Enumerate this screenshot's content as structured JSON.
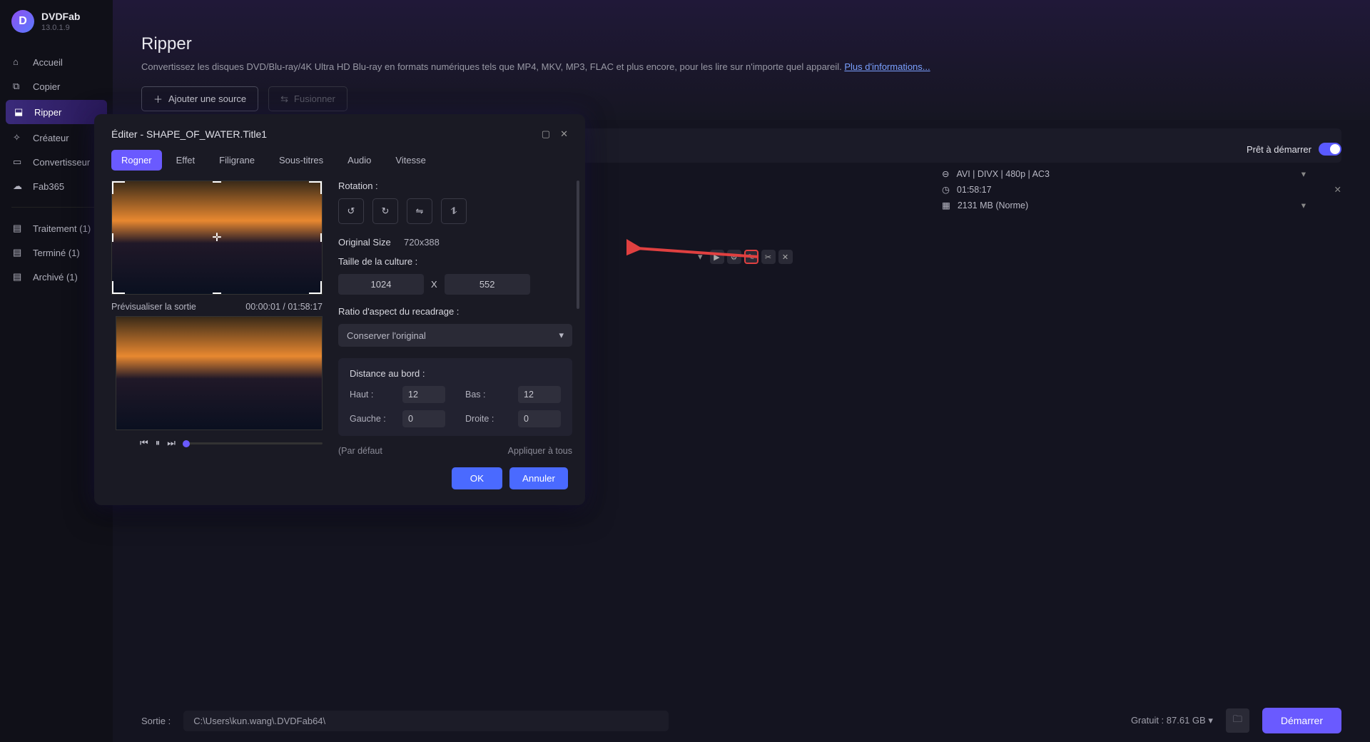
{
  "app": {
    "name": "DVDFab",
    "version": "13.0.1.9"
  },
  "sidebar": {
    "items": [
      {
        "label": "Accueil"
      },
      {
        "label": "Copier"
      },
      {
        "label": "Ripper"
      },
      {
        "label": "Créateur"
      },
      {
        "label": "Convertisseur"
      },
      {
        "label": "Fab365"
      }
    ],
    "status": [
      {
        "label": "Traitement (1)"
      },
      {
        "label": "Terminé (1)"
      },
      {
        "label": "Archivé (1)"
      }
    ]
  },
  "page": {
    "title": "Ripper",
    "desc": "Convertissez les disques DVD/Blu-ray/4K Ultra HD Blu-ray en formats numériques tels que MP4, MKV, MP3, FLAC et plus encore, pour les lire sur n'importe quel appareil. ",
    "more": "Plus d'informations...",
    "add_source": "Ajouter une source",
    "merge": "Fusionner"
  },
  "item": {
    "ready": "Prêt à démarrer",
    "format": "AVI | DIVX | 480p | AC3",
    "duration": "01:58:17",
    "size": "2131 MB (Norme)"
  },
  "footer": {
    "label": "Sortie :",
    "path": "C:\\Users\\kun.wang\\.DVDFab64\\",
    "free": "Gratuit : 87.61 GB",
    "start": "Démarrer"
  },
  "modal": {
    "title": "Éditer - SHAPE_OF_WATER.Title1",
    "tabs": [
      "Rogner",
      "Effet",
      "Filigrane",
      "Sous-titres",
      "Audio",
      "Vitesse"
    ],
    "preview_label": "Prévisualiser la sortie",
    "preview_time": "00:00:01 / 01:58:17",
    "rotation_label": "Rotation :",
    "orig_size_label": "Original Size",
    "orig_size": "720x388",
    "crop_size_label": "Taille de la culture :",
    "crop_w": "1024",
    "crop_h": "552",
    "x_sep": "X",
    "aspect_label": "Ratio d'aspect du recadrage :",
    "aspect_value": "Conserver l'original",
    "edge_label": "Distance au bord :",
    "edge": {
      "top_l": "Haut :",
      "top": "12",
      "bottom_l": "Bas :",
      "bottom": "12",
      "left_l": "Gauche :",
      "left": "0",
      "right_l": "Droite :",
      "right": "0"
    },
    "default": "(Par défaut",
    "apply_all": "Appliquer à tous",
    "ok": "OK",
    "cancel": "Annuler"
  }
}
